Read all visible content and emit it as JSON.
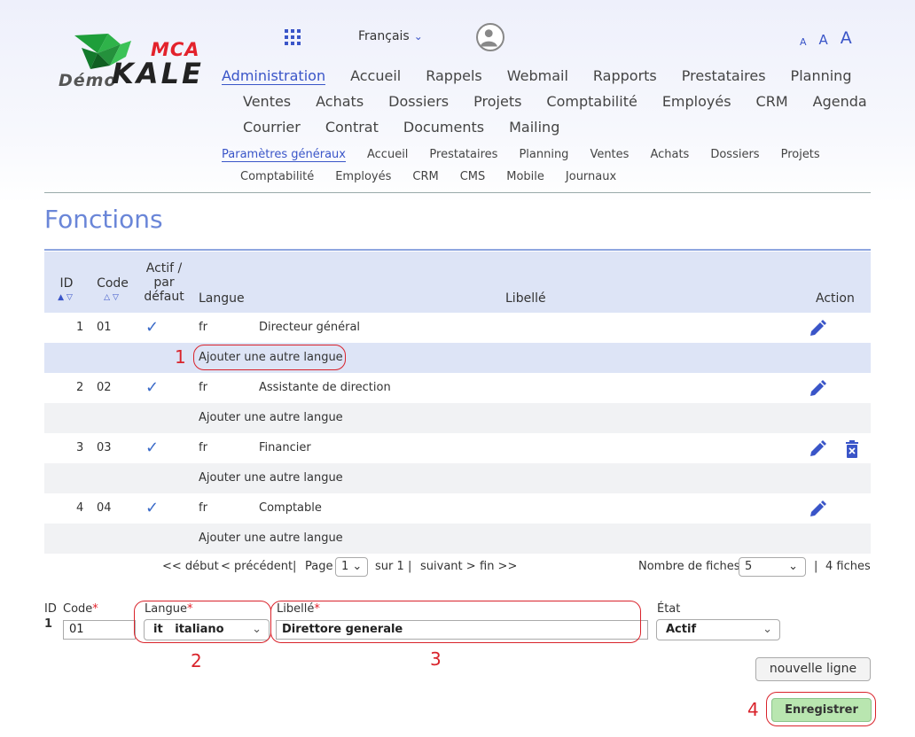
{
  "header": {
    "logo_demo": "Démo",
    "logo_brand": "KALE",
    "logo_mca": "MCA",
    "language": "Français",
    "font_sizes": [
      "A",
      "A",
      "A"
    ]
  },
  "menu": {
    "main": [
      "Administration",
      "Accueil",
      "Rappels",
      "Webmail",
      "Rapports",
      "Prestataires",
      "Planning",
      "Ventes",
      "Achats",
      "Dossiers",
      "Projets",
      "Comptabilité",
      "Employés",
      "CRM",
      "Agenda",
      "Courrier",
      "Contrat",
      "Documents",
      "Mailing"
    ],
    "sub": [
      "Paramètres généraux",
      "Accueil",
      "Prestataires",
      "Planning",
      "Ventes",
      "Achats",
      "Dossiers",
      "Projets",
      "Comptabilité",
      "Employés",
      "CRM",
      "CMS",
      "Mobile",
      "Journaux"
    ]
  },
  "page_title": "Fonctions",
  "table": {
    "headers": {
      "id": "ID",
      "code": "Code",
      "active_l1": "Actif /",
      "active_l2": "par",
      "active_l3": "défaut",
      "language": "Langue",
      "label": "Libellé",
      "action": "Action"
    },
    "add_language": "Ajouter une autre langue",
    "rows": [
      {
        "id": "1",
        "code": "01",
        "lang": "fr",
        "label": "Directeur général"
      },
      {
        "id": "2",
        "code": "02",
        "lang": "fr",
        "label": "Assistante de direction"
      },
      {
        "id": "3",
        "code": "03",
        "lang": "fr",
        "label": "Financier"
      },
      {
        "id": "4",
        "code": "04",
        "lang": "fr",
        "label": "Comptable"
      }
    ]
  },
  "pagination": {
    "start": "<< début",
    "prev": "< précédent",
    "page_label": "Page",
    "page_value": "1",
    "of": "sur 1",
    "next": "suivant >",
    "end": "fin >>",
    "records_label": "Nombre de fiches",
    "records_value": "5",
    "total": "4 fiches"
  },
  "form": {
    "id_label": "ID",
    "id_value": "1",
    "code_label": "Code",
    "code_value": "01",
    "lang_label": "Langue",
    "lang_value": "it   italiano",
    "libelle_label": "Libellé",
    "libelle_value": "Direttore generale",
    "state_label": "État",
    "state_value": "Actif",
    "required_mark": "*",
    "new_line": "nouvelle ligne",
    "save": "Enregistrer"
  },
  "annotations": [
    "1",
    "2",
    "3",
    "4"
  ],
  "colors": {
    "accent": "#3a55c8",
    "annotation": "#d9232b",
    "save_bg": "#b9e6b0"
  }
}
